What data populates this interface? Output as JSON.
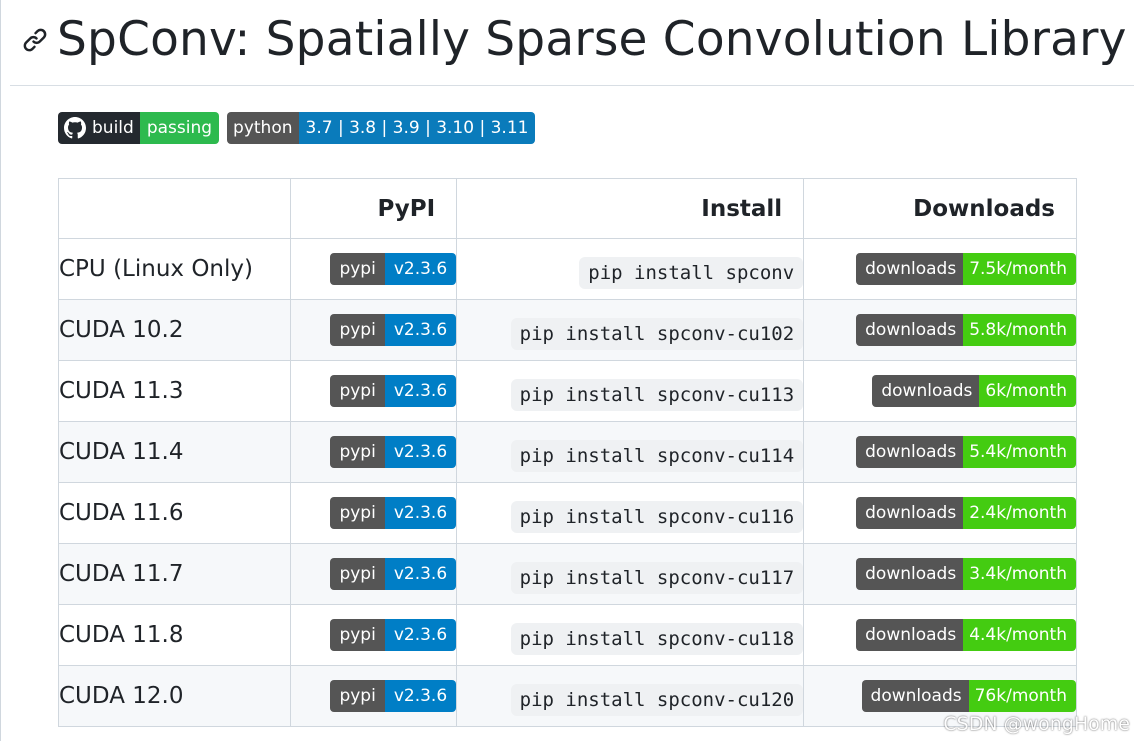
{
  "heading": {
    "title": "SpConv: Spatially Sparse Convolution Library",
    "anchor_icon": "link-icon"
  },
  "badges": {
    "build": {
      "label": "build",
      "status": "passing",
      "icon": "github-icon",
      "status_color": "#2dba4e",
      "label_color": "#24292f"
    },
    "python": {
      "label": "python",
      "versions": "3.7 | 3.8 | 3.9 | 3.10 | 3.11",
      "value_color": "#0a7bbb"
    }
  },
  "table": {
    "headers": [
      "",
      "PyPI",
      "Install",
      "Downloads"
    ],
    "badge_labels": {
      "pypi": "pypi",
      "downloads": "downloads"
    },
    "rows": [
      {
        "label": "CPU (Linux Only)",
        "pypi_version": "v2.3.6",
        "install": "pip install spconv",
        "downloads": "7.5k/month"
      },
      {
        "label": "CUDA 10.2",
        "pypi_version": "v2.3.6",
        "install": "pip install spconv-cu102",
        "downloads": "5.8k/month"
      },
      {
        "label": "CUDA 11.3",
        "pypi_version": "v2.3.6",
        "install": "pip install spconv-cu113",
        "downloads": "6k/month"
      },
      {
        "label": "CUDA 11.4",
        "pypi_version": "v2.3.6",
        "install": "pip install spconv-cu114",
        "downloads": "5.4k/month"
      },
      {
        "label": "CUDA 11.6",
        "pypi_version": "v2.3.6",
        "install": "pip install spconv-cu116",
        "downloads": "2.4k/month"
      },
      {
        "label": "CUDA 11.7",
        "pypi_version": "v2.3.6",
        "install": "pip install spconv-cu117",
        "downloads": "3.4k/month"
      },
      {
        "label": "CUDA 11.8",
        "pypi_version": "v2.3.6",
        "install": "pip install spconv-cu118",
        "downloads": "4.4k/month"
      },
      {
        "label": "CUDA 12.0",
        "pypi_version": "v2.3.6",
        "install": "pip install spconv-cu120",
        "downloads": "76k/month"
      }
    ]
  },
  "watermark": "CSDN @wongHome"
}
